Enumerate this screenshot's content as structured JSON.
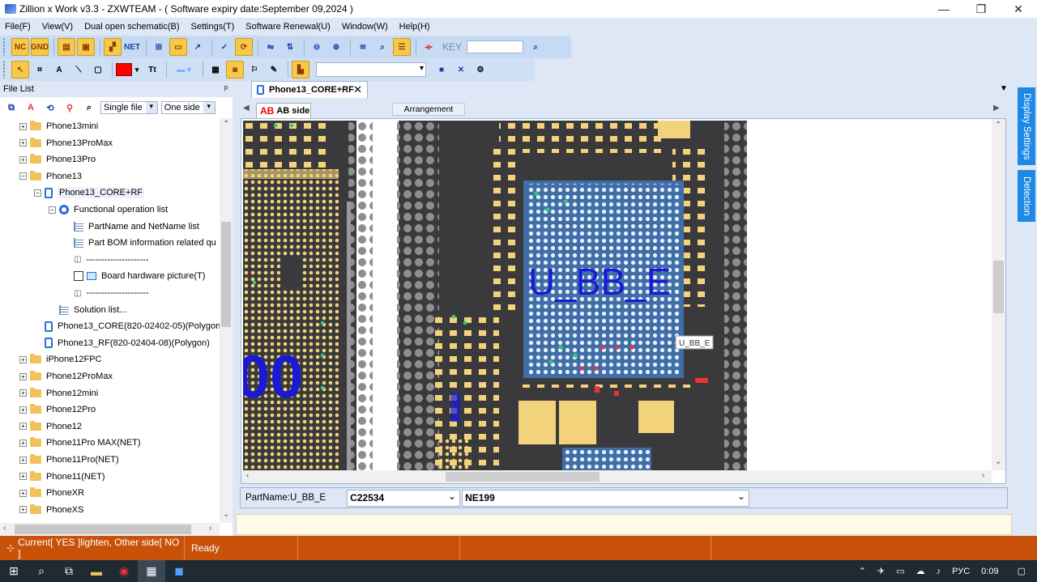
{
  "window": {
    "title": "Zillion x Work v3.3 - ZXWTEAM - ( Software expiry date:September 09,2024 )",
    "minimize": "—",
    "restore": "❐",
    "close": "✕"
  },
  "menu": [
    "File(F)",
    "View(V)",
    "Dual open schematic(B)",
    "Settings(T)",
    "Software Renewal(U)",
    "Window(W)",
    "Help(H)"
  ],
  "toolbar": {
    "nc_label": "NC",
    "gnd_label": "GND",
    "net_label": "NET",
    "key_label": "KEY",
    "key_value": ""
  },
  "file_list": {
    "title": "File List",
    "pin": "ᵖ",
    "file_mode": "Single file",
    "side_mode": "One side",
    "tree": [
      {
        "label": "Phone13mini",
        "level": 0,
        "type": "folder",
        "exp": "+"
      },
      {
        "label": "Phone13ProMax",
        "level": 0,
        "type": "folder",
        "exp": "+"
      },
      {
        "label": "Phone13Pro",
        "level": 0,
        "type": "folder",
        "exp": "+"
      },
      {
        "label": "Phone13",
        "level": 0,
        "type": "folder",
        "exp": "−"
      },
      {
        "label": "Phone13_CORE+RF",
        "level": 1,
        "type": "doc",
        "exp": "−"
      },
      {
        "label": "Functional operation list",
        "level": 2,
        "type": "gear",
        "exp": "−"
      },
      {
        "label": "PartName and NetName list",
        "level": 3,
        "type": "list",
        "exp": ""
      },
      {
        "label": "Part BOM information related qu",
        "level": 3,
        "type": "list",
        "exp": ""
      },
      {
        "label": "---------------------",
        "level": 3,
        "type": "link",
        "exp": ""
      },
      {
        "label": "Board hardware picture(T)",
        "level": 3,
        "type": "picture",
        "exp": ""
      },
      {
        "label": "---------------------",
        "level": 3,
        "type": "link",
        "exp": ""
      },
      {
        "label": "Solution list...",
        "level": 2,
        "type": "list",
        "exp": ""
      },
      {
        "label": "Phone13_CORE(820-02402-05)(Polygon",
        "level": 1,
        "type": "doc",
        "exp": ""
      },
      {
        "label": "Phone13_RF(820-02404-08)(Polygon)",
        "level": 1,
        "type": "doc",
        "exp": ""
      },
      {
        "label": "iPhone12FPC",
        "level": 0,
        "type": "folder",
        "exp": "+"
      },
      {
        "label": "Phone12ProMax",
        "level": 0,
        "type": "folder",
        "exp": "+"
      },
      {
        "label": "Phone12mini",
        "level": 0,
        "type": "folder",
        "exp": "+"
      },
      {
        "label": "Phone12Pro",
        "level": 0,
        "type": "folder",
        "exp": "+"
      },
      {
        "label": " Phone12",
        "level": 0,
        "type": "folder",
        "exp": "+"
      },
      {
        "label": "Phone11Pro MAX(NET)",
        "level": 0,
        "type": "folder",
        "exp": "+"
      },
      {
        "label": "Phone11Pro(NET)",
        "level": 0,
        "type": "folder",
        "exp": "+"
      },
      {
        "label": "Phone11(NET)",
        "level": 0,
        "type": "folder",
        "exp": "+"
      },
      {
        "label": "PhoneXR",
        "level": 0,
        "type": "folder",
        "exp": "+"
      },
      {
        "label": "PhoneXS",
        "level": 0,
        "type": "folder",
        "exp": "+"
      }
    ]
  },
  "document": {
    "tab_label": "Phone13_CORE+RF",
    "tab_close": "✕",
    "side_badge": "AB",
    "side_label": "AB side",
    "arrangement_label": "Arrangement",
    "chip_label": "U_BB_E",
    "chip_tag": "U_BB_E",
    "big_label": "00",
    "part_name": "PartName:U_BB_E",
    "part_value": "C22534",
    "net_value": "NE199"
  },
  "side_tabs": {
    "display": "Display Settings",
    "detection": "Detection"
  },
  "status": {
    "current": "Current[ YES ]lighten, Other side[ NO ]",
    "ready": "Ready"
  },
  "taskbar": {
    "lang": "РУС",
    "time": "0:09"
  },
  "colors": {
    "board": "#3a3a3c",
    "pad": "#f2d27a",
    "chip": "#3f6fa6",
    "label_blue": "#1a1ad6",
    "status_bar": "#c9520b"
  }
}
